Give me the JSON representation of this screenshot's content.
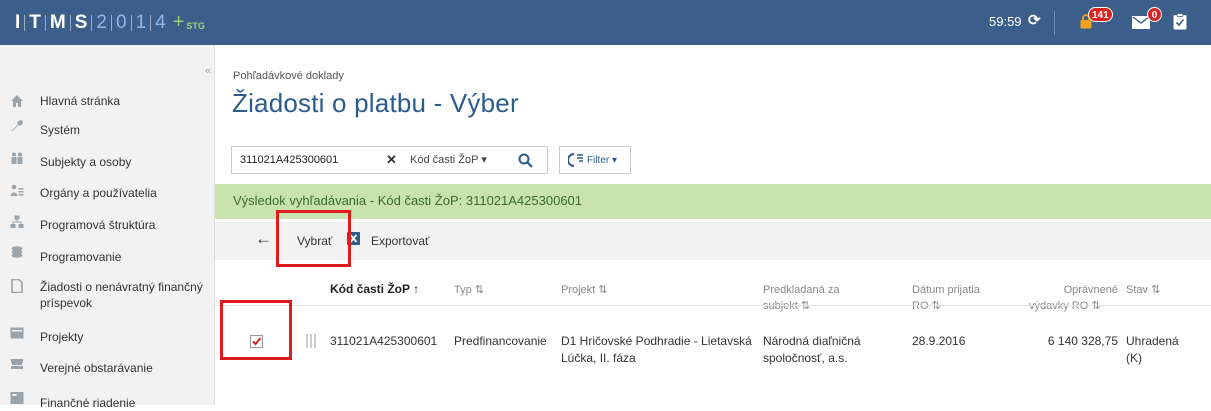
{
  "app": {
    "logo_letters": [
      "I",
      "T",
      "M",
      "S"
    ],
    "logo_digits": [
      "2",
      "0",
      "1",
      "4"
    ],
    "logo_plus": "+",
    "logo_env": "STG",
    "session_timer": "59:59",
    "lock_badge": "141",
    "mail_badge": "0",
    "colors": {
      "topbar": "#3b5f8a",
      "title": "#2c5c8c",
      "result_bar": "#c9e3ae",
      "highlight": "#e01b1b"
    }
  },
  "sidebar": {
    "items": [
      {
        "label": "Hlavná stránka",
        "icon": "home-icon"
      },
      {
        "label": "Systém",
        "icon": "wrench-icon"
      },
      {
        "label": "Subjekty a osoby",
        "icon": "people-icon"
      },
      {
        "label": "Orgány a používatelia",
        "icon": "user-list-icon"
      },
      {
        "label": "Programová štruktúra",
        "icon": "structure-icon"
      },
      {
        "label": "Programovanie",
        "icon": "coins-icon"
      },
      {
        "label": "Žiadosti o nenávratný finančný príspevok",
        "icon": "document-icon"
      },
      {
        "label": "Projekty",
        "icon": "folder-icon"
      },
      {
        "label": "Verejné obstarávanie",
        "icon": "cart-icon"
      },
      {
        "label": "Finančné riadenie",
        "icon": "finance-icon"
      }
    ]
  },
  "page": {
    "breadcrumb": "Pohľadávkové doklady",
    "title": "Žiadosti o platbu - Výber"
  },
  "search": {
    "value": "311021A425300601",
    "field": "Kód časti ŽoP ▾",
    "filter_label": "Filter ▾"
  },
  "result": {
    "text": "Výsledok vyhľadávania - Kód časti ŽoP: 311021A425300601"
  },
  "toolbar": {
    "select_label": "Vybrať",
    "export_label": "Exportovať"
  },
  "table": {
    "headers": {
      "code": "Kód časti ŽoP ↑",
      "type": "Typ ⇅",
      "project": "Projekt ⇅",
      "submitter_1": "Predkladaná za",
      "submitter_2": "subjekt ⇅",
      "received_1": "Dátum prijatia",
      "received_2": "RO ⇅",
      "eligible_1": "Oprávnené",
      "eligible_2": "výdavky RO ⇅",
      "status": "Stav ⇅"
    },
    "row": {
      "selected": true,
      "code": "311021A425300601",
      "type": "Predfinancovanie",
      "project_1": "D1 Hričovské Podhradie - Lietavská",
      "project_2": "Lúčka, II. fáza",
      "submitter_1": "Národná diaľničná",
      "submitter_2": "spoločnosť, a.s.",
      "received": "28.9.2016",
      "eligible": "6 140 328,75",
      "status_1": "Uhradená",
      "status_2": "(K)"
    }
  }
}
